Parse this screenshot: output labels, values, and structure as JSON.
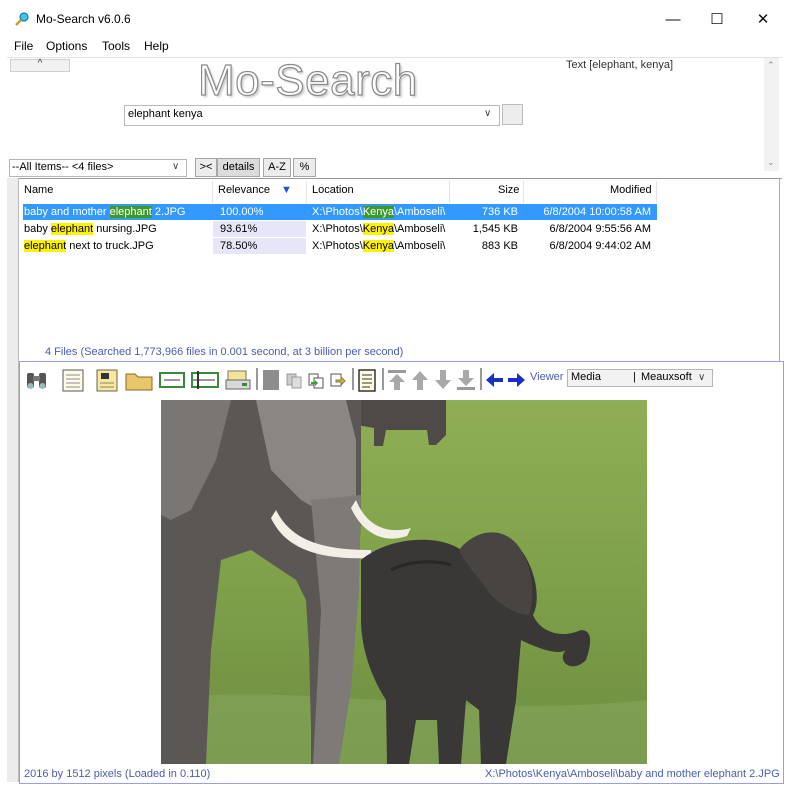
{
  "window": {
    "title": "Mo-Search v6.0.6",
    "minimize": "—",
    "maximize": "☐",
    "close": "✕"
  },
  "menu": [
    "File",
    "Options",
    "Tools",
    "Help"
  ],
  "search": {
    "collapse_glyph": "^",
    "logo": "Mo-Search",
    "query_label": "Text [elephant, kenya]",
    "query": "elephant kenya",
    "dropdown_glyph": "∨",
    "filter_value": "--All Items-- <4 files>",
    "view_buttons": [
      "><",
      "details",
      "A-Z",
      "%"
    ]
  },
  "list": {
    "columns": [
      "Name",
      "Relevance",
      "Location",
      "Size",
      "Modified"
    ],
    "sort_indicator": "▼",
    "rows": [
      {
        "name_pre": "baby and mother ",
        "name_hl": "elephant",
        "name_post": " 2.JPG",
        "relevance": "100.00%",
        "loc_pre": "X:\\Photos\\",
        "loc_hl": "Kenya",
        "loc_post": "\\Amboseli\\",
        "size": "736 KB",
        "modified": "6/8/2004 10:00:58 AM"
      },
      {
        "name_pre": "baby ",
        "name_hl": "elephant",
        "name_post": " nursing.JPG",
        "relevance": "93.61%",
        "loc_pre": "X:\\Photos\\",
        "loc_hl": "Kenya",
        "loc_post": "\\Amboseli\\",
        "size": "1,545 KB",
        "modified": "6/8/2004 9:55:56 AM"
      },
      {
        "name_pre": "",
        "name_hl": "elephant",
        "name_post": " next to truck.JPG",
        "relevance": "78.50%",
        "loc_pre": "X:\\Photos\\",
        "loc_hl": "Kenya",
        "loc_post": "\\Amboseli\\",
        "size": "883 KB",
        "modified": "6/8/2004 9:44:02 AM"
      }
    ],
    "status": "4 Files  (Searched 1,773,966 files in 0.001 second, at 3 billion per second)"
  },
  "viewer": {
    "label": "Viewer",
    "combo_value": "Media",
    "combo_value2": "Meauxsoft",
    "image_info": "2016 by 1512 pixels (Loaded in 0.110)",
    "image_path": "X:\\Photos\\Kenya\\Amboseli\\baby and mother elephant 2.JPG"
  },
  "colors": {
    "selection": "#3399ff",
    "match_selected": "#3c9a2c",
    "match": "#fff200",
    "status_text": "#4a5cb0",
    "nav_arrow": "#1a2ec8"
  }
}
